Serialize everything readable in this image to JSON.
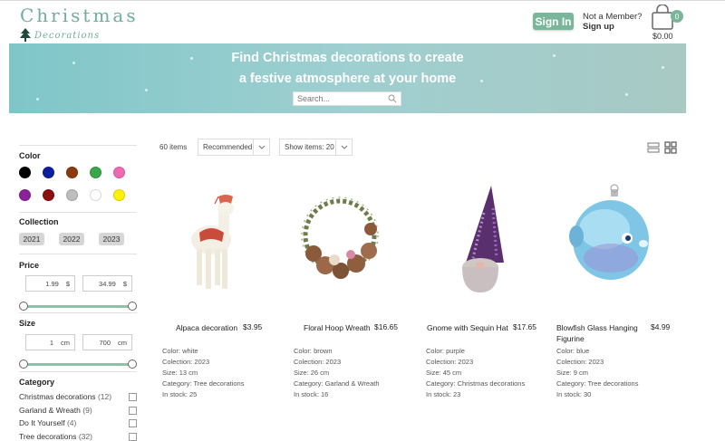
{
  "brand": {
    "title": "Christmas",
    "subtitle": "Decorations"
  },
  "header": {
    "signin_label": "Sign In",
    "not_member": "Not a Member?",
    "signup_label": "Sign up",
    "cart_count": "0",
    "cart_total": "$0.00"
  },
  "hero": {
    "line1": "Find Christmas decorations to create",
    "line2": "a festive atmosphere at your home",
    "search_placeholder": "Search..."
  },
  "colors": {
    "accent": "#79b69a",
    "hero_start": "#7fc6c9",
    "hero_end": "#a8c9c4"
  },
  "filters": {
    "color_label": "Color",
    "color_swatches": [
      "#000000",
      "#0a1ea0",
      "#8b3a0e",
      "#3aa64a",
      "#f06bb4",
      "#8e1f9e",
      "#8e0f0f",
      "#bdbdbd",
      "#ffffff",
      "#fff200"
    ],
    "collection_label": "Collection",
    "years": [
      "2021",
      "2022",
      "2023"
    ],
    "price_label": "Price",
    "price_min": "1.99",
    "price_max": "34.99",
    "price_unit": "$",
    "size_label": "Size",
    "size_min": "1",
    "size_max": "700",
    "size_unit": "cm",
    "category_label": "Category",
    "categories": [
      {
        "name": "Christmas decorations",
        "count": "(12)"
      },
      {
        "name": "Garland & Wreath",
        "count": "(9)"
      },
      {
        "name": "Do It Yourself",
        "count": "(4)"
      },
      {
        "name": "Tree decorations",
        "count": "(32)"
      }
    ]
  },
  "toolbar": {
    "items_count": "60 items",
    "sort": "Recommended",
    "show_items": "Show items: 20",
    "view_list_icon": "list-view-icon",
    "view_grid_icon": "grid-view-icon"
  },
  "products": [
    {
      "name": "Alpaca decoration",
      "price": "$3.95",
      "color": "Color: white",
      "collection": "Colection: 2023",
      "size": "Size: 13 cm",
      "category": "Category: Tree decorations",
      "stock": "In stock: 25"
    },
    {
      "name": "Floral Hoop Wreath",
      "price": "$16.65",
      "color": "Color: brown",
      "collection": "Colection: 2023",
      "size": "Size: 26 cm",
      "category": "Category: Garland & Wreath",
      "stock": "In stock: 16"
    },
    {
      "name": "Gnome with Sequin Hat",
      "price": "$17.65",
      "color": "Color: purple",
      "collection": "Colection: 2023",
      "size": "Size: 45 cm",
      "category": "Category: Christmas decorations",
      "stock": "In stock: 23"
    },
    {
      "name_line1": "Blowfish Glass Hanging",
      "name_line2": "Figurine",
      "price": "$4.99",
      "color": "Color: blue",
      "collection": "Colection: 2023",
      "size": "Size: 9 cm",
      "category": "Category: Tree decorations",
      "stock": "In stock: 30"
    }
  ]
}
